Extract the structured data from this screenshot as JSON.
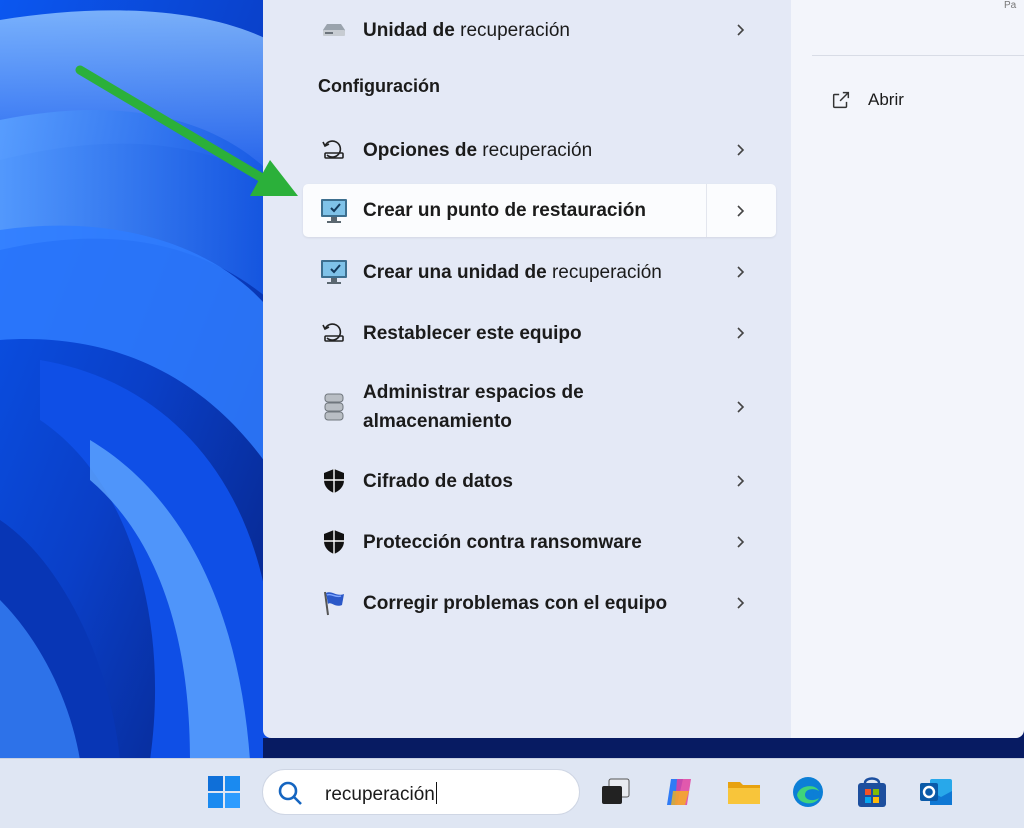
{
  "search_panel": {
    "section_heading": "Configuración",
    "items": [
      {
        "name_bold": "Unidad de",
        "name_rest": " recuperación",
        "icon": "drive-icon"
      },
      {
        "name_bold": "Opciones de",
        "name_rest": " recuperación",
        "icon": "recovery-icon"
      },
      {
        "name_bold": "Crear un punto de restauración",
        "name_rest": "",
        "icon": "system-protection-icon",
        "selected": true
      },
      {
        "name_bold": "Crear una unidad de",
        "name_rest": " recuperación",
        "icon": "system-protection-icon"
      },
      {
        "name_bold": "Restablecer este equipo",
        "name_rest": "",
        "icon": "recovery-icon"
      },
      {
        "name_bold": "Administrar espacios de",
        "name_line2": "almacenamiento",
        "icon": "storage-spaces-icon"
      },
      {
        "name_bold": "Cifrado de datos",
        "name_rest": "",
        "icon": "shield-icon"
      },
      {
        "name_bold": "Protección contra ransomware",
        "name_rest": "",
        "icon": "shield-icon"
      },
      {
        "name_bold": "Corregir problemas con el equipo",
        "name_rest": "",
        "icon": "flag-icon"
      }
    ]
  },
  "preview": {
    "edge_text": "Pa",
    "open_label": "Abrir"
  },
  "taskbar": {
    "search_value": "recuperación",
    "apps": [
      "windows-start-icon",
      "task-view-icon",
      "copilot-icon",
      "file-explorer-icon",
      "edge-icon",
      "store-icon",
      "outlook-icon"
    ]
  },
  "colors": {
    "accent_arrow": "#2bb03a",
    "panel_bg": "#e4e9f6",
    "selected_bg": "#fbfcfe"
  }
}
